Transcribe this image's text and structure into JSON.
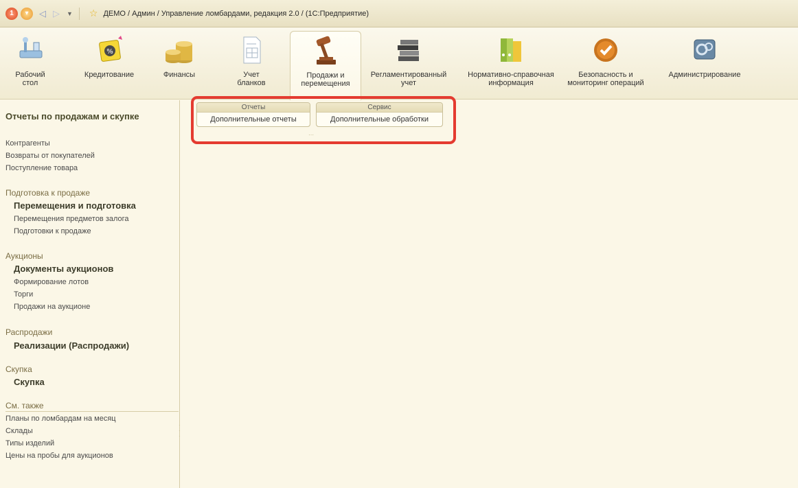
{
  "titlebar": {
    "title": "ДЕМО / Админ / Управление ломбардами, редакция 2.0 /  (1С:Предприятие)",
    "logo_icon": "1c-logo-icon",
    "menu_icon": "main-menu-icon",
    "back_icon": "back-arrow-icon",
    "forward_icon": "forward-arrow-icon",
    "dropdown_icon": "chevron-down-icon",
    "favorites_icon": "star-icon"
  },
  "sections": [
    {
      "label": "Рабочий\nстол",
      "icon": "desktop-icon"
    },
    {
      "label": "Кредитование",
      "icon": "percent-folder-icon"
    },
    {
      "label": "Финансы",
      "icon": "coins-icon"
    },
    {
      "label": "Учет\nбланков",
      "icon": "document-icon"
    },
    {
      "label": "Продажи и\nперемещения",
      "icon": "gavel-icon",
      "active": true
    },
    {
      "label": "Регламентированный\nучет",
      "icon": "books-icon"
    },
    {
      "label": "Нормативно-справочная\nинформация",
      "icon": "binders-icon"
    },
    {
      "label": "Безопасность и\nмониторинг операций",
      "icon": "shield-icon"
    },
    {
      "label": "Администрирование",
      "icon": "gears-icon"
    }
  ],
  "left_panel": {
    "title": "Отчеты по продажам и скупке",
    "top_items": [
      "Контрагенты",
      "Возвраты от покупателей",
      "Поступление товара"
    ],
    "groups": [
      {
        "header": "Подготовка к продаже",
        "bold": "Перемещения и подготовка",
        "items": [
          "Перемещения предметов залога",
          "Подготовки к продаже"
        ]
      },
      {
        "header": "Аукционы",
        "bold": "Документы аукционов",
        "items": [
          "Формирование лотов",
          "Торги",
          "Продажи на аукционе"
        ]
      },
      {
        "header": "Распродажи",
        "bold": "Реализации (Распродажи)",
        "items": []
      },
      {
        "header": "Скупка",
        "bold": "Скупка",
        "items": []
      }
    ],
    "see_also": {
      "header": "См. также",
      "items": [
        "Планы по ломбардам на месяц",
        "Склады",
        "Типы изделий",
        "Цены на пробы для аукционов"
      ]
    }
  },
  "main": {
    "groups": [
      {
        "header": "Отчеты",
        "button": "Дополнительные отчеты"
      },
      {
        "header": "Сервис",
        "button": "Дополнительные обработки"
      }
    ]
  },
  "colors": {
    "background": "#fbf7e7",
    "highlight": "#e43b30"
  }
}
